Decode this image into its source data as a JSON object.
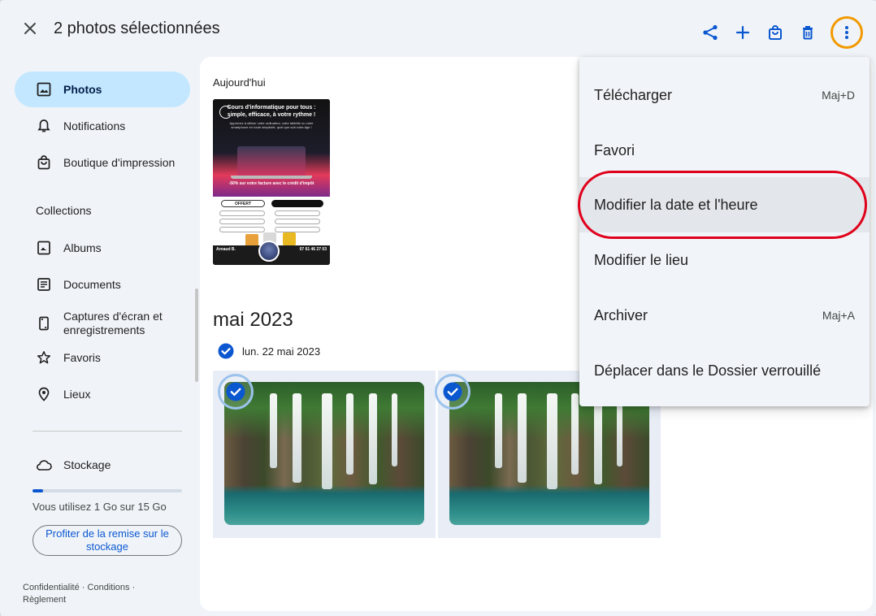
{
  "topbar": {
    "title": "2 photos sélectionnées",
    "icons": [
      "close-icon",
      "share-icon",
      "add-icon",
      "shopping-bag-icon",
      "delete-icon",
      "more-vert-icon"
    ]
  },
  "sidebar": {
    "nav": [
      {
        "label": "Photos",
        "icon": "photo-icon",
        "active": true
      },
      {
        "label": "Notifications",
        "icon": "bell-icon"
      },
      {
        "label": "Boutique d'impression",
        "icon": "shopping-bag-icon"
      }
    ],
    "collections_title": "Collections",
    "collections": [
      {
        "label": "Albums",
        "icon": "album-icon"
      },
      {
        "label": "Documents",
        "icon": "document-icon"
      },
      {
        "label": "Captures d'écran et enregistrements",
        "icon": "screenshot-icon"
      },
      {
        "label": "Favoris",
        "icon": "star-icon"
      },
      {
        "label": "Lieux",
        "icon": "location-pin-icon"
      }
    ],
    "storage": {
      "label": "Stockage",
      "icon": "cloud-icon",
      "usage_text": "Vous utilisez 1 Go sur 15 Go",
      "used_fraction": 0.07,
      "promo_button": "Profiter de la remise sur le stockage"
    },
    "footer": {
      "privacy": "Confidentialité",
      "terms": "Conditions",
      "policy": "Règlement",
      "separator": "·"
    }
  },
  "main": {
    "today_label": "Aujourd'hui",
    "flyer": {
      "title": "Cours d'informatique pour tous : simple, efficace, à votre rythme !",
      "subtitle": "Apprenez à utiliser votre ordinateur, votre tablette ou votre smartphone en toute simplicité, quel que soit votre âge !",
      "promo": "-50% sur votre facture avec le crédit d'impôt",
      "offer": "OFFERT",
      "name": "Arnaud B.",
      "phone": "07 61 46 27 03"
    },
    "month_title": "mai 2023",
    "date_label": "lun. 22 mai 2023",
    "photos_selected": [
      true,
      true
    ]
  },
  "menu": {
    "items": [
      {
        "label": "Télécharger",
        "shortcut": "Maj+D"
      },
      {
        "label": "Favori",
        "shortcut": ""
      },
      {
        "label": "Modifier la date et l'heure",
        "shortcut": "",
        "highlighted": true
      },
      {
        "label": "Modifier le lieu",
        "shortcut": ""
      },
      {
        "label": "Archiver",
        "shortcut": "Maj+A"
      },
      {
        "label": "Déplacer dans le Dossier verrouillé",
        "shortcut": ""
      }
    ]
  },
  "colors": {
    "accent": "#0b57d0",
    "active_nav": "#c2e7ff",
    "annotation_orange": "#f29900",
    "annotation_red": "#e0001b",
    "selection_ring": "#9cc3ec"
  }
}
